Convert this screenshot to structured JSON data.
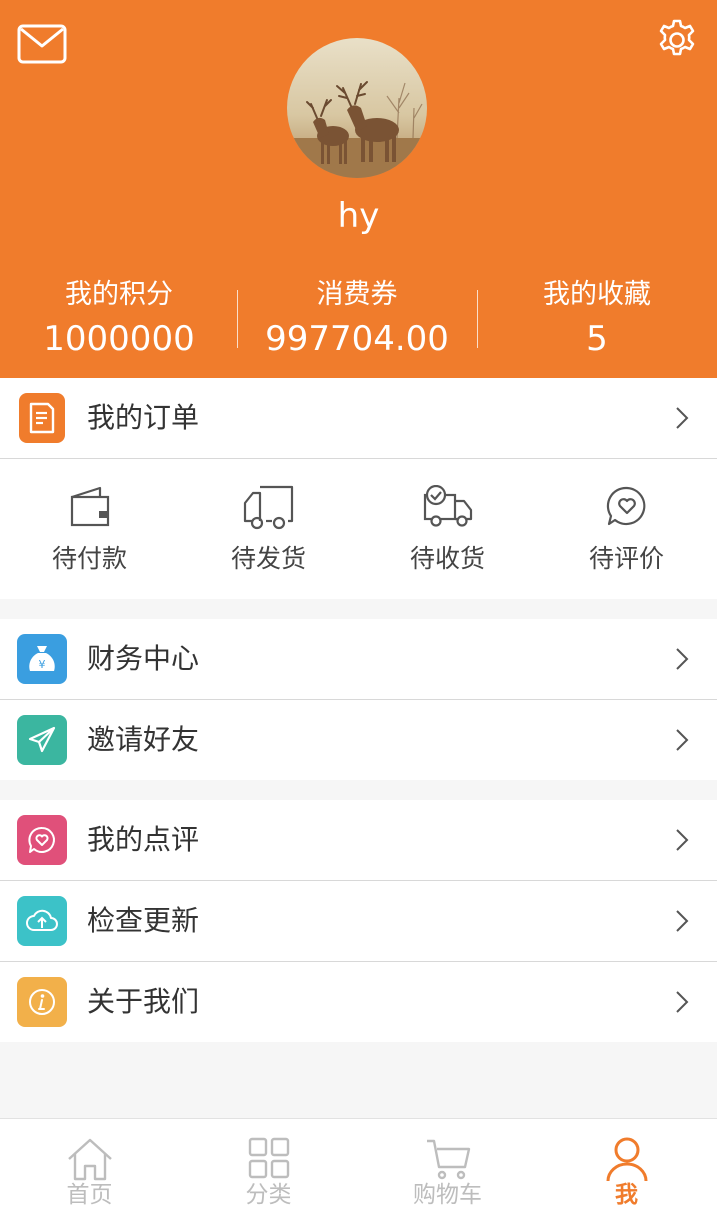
{
  "header": {
    "username": "hy",
    "stats": [
      {
        "label": "我的积分",
        "value": "1000000"
      },
      {
        "label": "消费券",
        "value": "997704.00"
      },
      {
        "label": "我的收藏",
        "value": "5"
      }
    ]
  },
  "orders": {
    "title": "我的订单",
    "items": [
      {
        "label": "待付款",
        "icon": "wallet-icon"
      },
      {
        "label": "待发货",
        "icon": "truck-icon"
      },
      {
        "label": "待收货",
        "icon": "delivery-truck-icon"
      },
      {
        "label": "待评价",
        "icon": "heart-chat-icon"
      }
    ]
  },
  "menu": {
    "finance": "财务中心",
    "invite": "邀请好友",
    "reviews": "我的点评",
    "update": "检查更新",
    "about": "关于我们"
  },
  "nav": {
    "home": "首页",
    "category": "分类",
    "cart": "购物车",
    "me": "我"
  },
  "colors": {
    "brand": "#f07c2c",
    "finance_icon": "#3a9ee0",
    "invite_icon": "#3bb6a0",
    "reviews_icon": "#e0507a",
    "update_icon": "#3cc2c8",
    "about_icon": "#f2b04a"
  }
}
